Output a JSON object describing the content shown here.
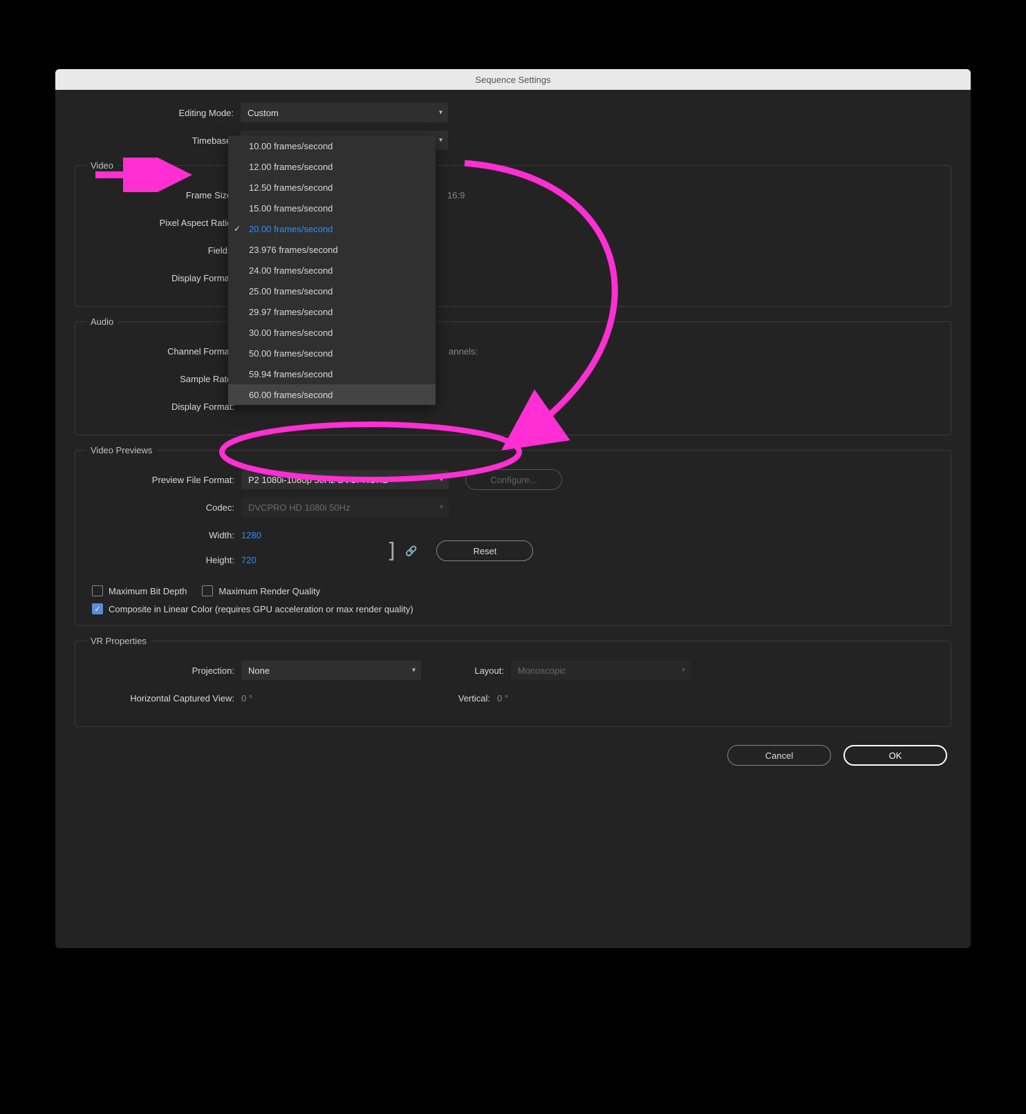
{
  "window_title": "Sequence Settings",
  "top": {
    "editing_mode_label": "Editing Mode:",
    "editing_mode_value": "Custom",
    "timebase_label": "Timebase:",
    "timebase_value": "20.00  frames/second",
    "timebase_options": [
      "10.00  frames/second",
      "12.00  frames/second",
      "12.50  frames/second",
      "15.00  frames/second",
      "20.00  frames/second",
      "23.976  frames/second",
      "24.00  frames/second",
      "25.00  frames/second",
      "29.97  frames/second",
      "30.00  frames/second",
      "50.00  frames/second",
      "59.94  frames/second",
      "60.00  frames/second"
    ],
    "selected_index": 4,
    "highlighted_index": 12
  },
  "video_section": {
    "legend": "Video",
    "frame_size_label": "Frame Size:",
    "aspect_note": "16:9",
    "pixel_aspect_label": "Pixel Aspect Ratio:",
    "fields_label": "Fields:",
    "display_format_label": "Display Format:"
  },
  "audio_section": {
    "legend": "Audio",
    "channel_format_label": "Channel Format:",
    "channels_label": "annels:",
    "sample_rate_label": "Sample Rate:",
    "display_format_label": "Display Format:"
  },
  "previews_section": {
    "legend": "Video Previews",
    "preview_file_format_label": "Preview File Format:",
    "preview_file_format_value": "P2 1080i-1080p 50Hz DVCPROHD",
    "configure_label": "Configure...",
    "codec_label": "Codec:",
    "codec_value": "DVCPRO HD 1080i 50Hz",
    "width_label": "Width:",
    "width_value": "1280",
    "height_label": "Height:",
    "height_value": "720",
    "reset_label": "Reset",
    "max_bit_depth_label": "Maximum Bit Depth",
    "max_render_quality_label": "Maximum Render Quality",
    "composite_label": "Composite in Linear Color (requires GPU acceleration or max render quality)"
  },
  "vr_section": {
    "legend": "VR Properties",
    "projection_label": "Projection:",
    "projection_value": "None",
    "layout_label": "Layout:",
    "layout_value": "Monoscopic",
    "horiz_label": "Horizontal Captured View:",
    "horiz_value": "0 °",
    "vert_label": "Vertical:",
    "vert_value": "0 °"
  },
  "footer": {
    "cancel": "Cancel",
    "ok": "OK"
  },
  "colors": {
    "annotation": "#ff2fd3"
  }
}
